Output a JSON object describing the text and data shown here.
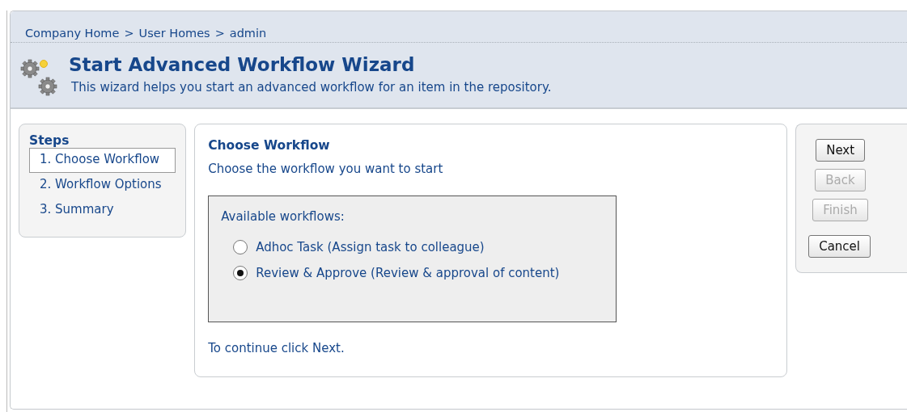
{
  "breadcrumb": {
    "items": [
      "Company Home",
      "User Homes",
      "admin"
    ],
    "separator": ">"
  },
  "header": {
    "title": "Start Advanced Workflow Wizard",
    "description": "This wizard helps you start an advanced workflow for an item in the repository."
  },
  "steps": {
    "title": "Steps",
    "items": [
      {
        "label": "1. Choose Workflow",
        "selected": true
      },
      {
        "label": "2. Workflow Options",
        "selected": false
      },
      {
        "label": "3. Summary",
        "selected": false
      }
    ]
  },
  "main": {
    "heading": "Choose Workflow",
    "instruction": "Choose the workflow you want to start",
    "group_label": "Available workflows:",
    "options": [
      {
        "label": "Adhoc Task (Assign task to colleague)",
        "selected": false
      },
      {
        "label": "Review & Approve (Review & approval of content)",
        "selected": true
      }
    ],
    "footer": "To continue click Next."
  },
  "buttons": [
    {
      "label": "Next",
      "disabled": false
    },
    {
      "label": "Back",
      "disabled": true
    },
    {
      "label": "Finish",
      "disabled": true
    },
    {
      "label": "Cancel",
      "disabled": false
    }
  ]
}
